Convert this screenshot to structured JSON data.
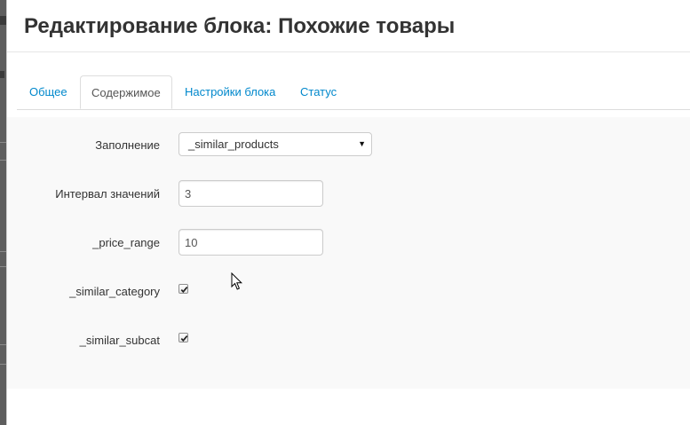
{
  "modal": {
    "title": "Редактирование блока: Похожие товары"
  },
  "tabs": [
    {
      "label": "Общее",
      "active": false
    },
    {
      "label": "Содержимое",
      "active": true
    },
    {
      "label": "Настройки блока",
      "active": false
    },
    {
      "label": "Статус",
      "active": false
    }
  ],
  "form": {
    "fill": {
      "label": "Заполнение",
      "selected": "_similar_products"
    },
    "interval": {
      "label": "Интервал значений",
      "value": "3"
    },
    "price_range": {
      "label": "_price_range",
      "value": "10"
    },
    "similar_category": {
      "label": "_similar_category",
      "checked": true
    },
    "similar_subcat": {
      "label": "_similar_subcat",
      "checked": true
    }
  },
  "colors": {
    "link": "#0088cc",
    "pane_background": "#f9f9f9",
    "backdrop": "#5e5e5e"
  },
  "icons": {
    "select_arrow": "triangle-down-icon",
    "checkbox_mark": "check-icon",
    "pointer": "mouse-cursor-icon"
  }
}
